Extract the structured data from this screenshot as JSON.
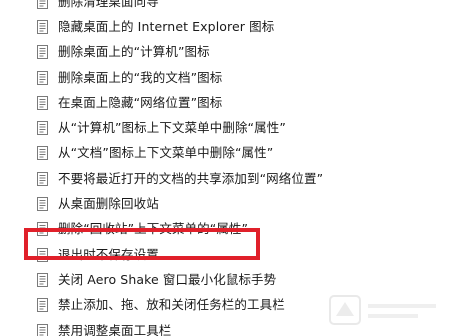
{
  "policy_list": {
    "items": [
      {
        "label": "删除清理桌面向导",
        "icon": "policy-setting-icon"
      },
      {
        "label": "隐藏桌面上的 Internet Explorer 图标",
        "icon": "policy-setting-icon"
      },
      {
        "label": "删除桌面上的“计算机”图标",
        "icon": "policy-setting-icon"
      },
      {
        "label": "删除桌面上的“我的文档”图标",
        "icon": "policy-setting-icon"
      },
      {
        "label": "在桌面上隐藏“网络位置”图标",
        "icon": "policy-setting-icon"
      },
      {
        "label": "从“计算机”图标上下文菜单中删除“属性”",
        "icon": "policy-setting-icon"
      },
      {
        "label": "从“文档”图标上下文菜单中删除“属性”",
        "icon": "policy-setting-icon"
      },
      {
        "label": "不要将最近打开的文档的共享添加到“网络位置”",
        "icon": "policy-setting-icon"
      },
      {
        "label": "从桌面删除回收站",
        "icon": "policy-setting-icon"
      },
      {
        "label": "删除“回收站”上下文菜单的“属性”",
        "icon": "policy-setting-icon"
      },
      {
        "label": "退出时不保存设置",
        "icon": "policy-setting-icon",
        "highlighted": true
      },
      {
        "label": "关闭 Aero Shake 窗口最小化鼠标手势",
        "icon": "policy-setting-icon"
      },
      {
        "label": "禁止添加、拖、放和关闭任务栏的工具栏",
        "icon": "policy-setting-icon"
      },
      {
        "label": "禁用调整桌面工具栏",
        "icon": "policy-setting-icon"
      }
    ]
  },
  "colors": {
    "highlight_border": "#e0202a",
    "text": "#1a1a1a",
    "background": "#ffffff"
  }
}
